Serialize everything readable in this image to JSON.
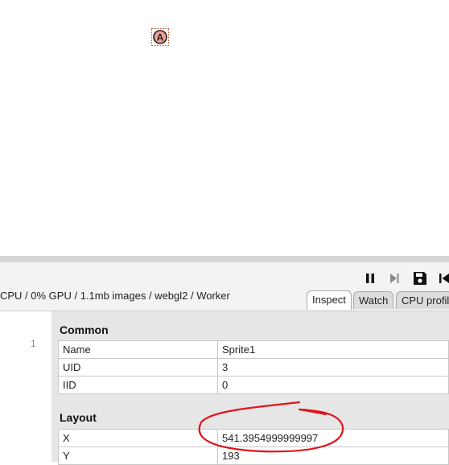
{
  "viewport": {
    "sprite_letter": "A"
  },
  "debugger": {
    "stats": "CPU / 0% GPU / 1.1mb images / webgl2 / Worker",
    "controls": [
      {
        "icon": "pause-icon"
      },
      {
        "icon": "step-icon"
      },
      {
        "icon": "save-icon"
      },
      {
        "icon": "restart-icon"
      }
    ],
    "tabs": [
      {
        "label": "Inspect",
        "active": true
      },
      {
        "label": "Watch",
        "active": false
      },
      {
        "label": "CPU profil",
        "active": false
      }
    ],
    "line_number": "1",
    "sections": [
      {
        "title": "Common",
        "rows": [
          {
            "key": "Name",
            "value": "Sprite1"
          },
          {
            "key": "UID",
            "value": "3"
          },
          {
            "key": "IID",
            "value": "0"
          }
        ]
      },
      {
        "title": "Layout",
        "rows": [
          {
            "key": "X",
            "value": "541.3954999999997"
          },
          {
            "key": "Y",
            "value": "193"
          }
        ]
      }
    ]
  },
  "colors": {
    "annotation": "#e0141c",
    "sprite": "#c0541f"
  }
}
